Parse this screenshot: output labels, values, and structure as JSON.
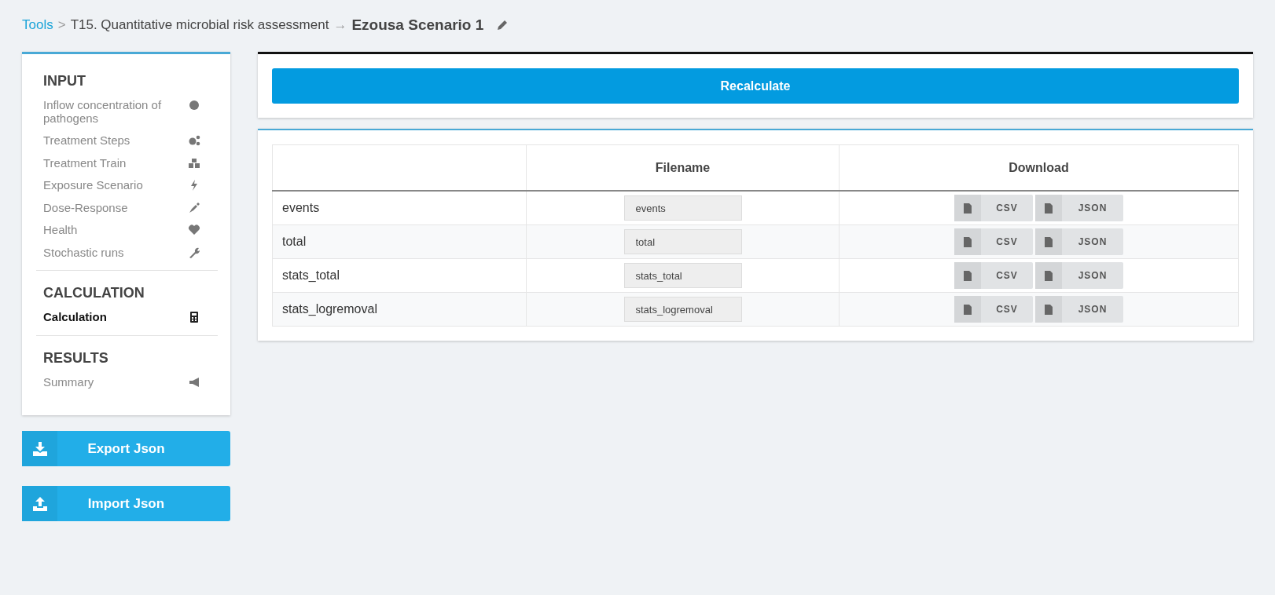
{
  "breadcrumb": {
    "root": "Tools",
    "separator_1": ">",
    "parent": "T15. Quantitative microbial risk assessment",
    "separator_2": "→",
    "current": "Ezousa Scenario 1"
  },
  "sidebar": {
    "sections": [
      {
        "title": "INPUT",
        "items": [
          {
            "label": "Inflow concentration of pathogens",
            "selected": false
          },
          {
            "label": "Treatment Steps",
            "selected": false
          },
          {
            "label": "Treatment Train",
            "selected": false
          },
          {
            "label": "Exposure Scenario",
            "selected": false
          },
          {
            "label": "Dose-Response",
            "selected": false
          },
          {
            "label": "Health",
            "selected": false
          },
          {
            "label": "Stochastic runs",
            "selected": false
          }
        ]
      },
      {
        "title": "CALCULATION",
        "items": [
          {
            "label": "Calculation",
            "selected": true
          }
        ]
      },
      {
        "title": "RESULTS",
        "items": [
          {
            "label": "Summary",
            "selected": false
          }
        ]
      }
    ]
  },
  "sidebar_buttons": [
    {
      "kind": "export",
      "label": "Export Json"
    },
    {
      "kind": "import",
      "label": "Import Json"
    }
  ],
  "recalculate_button": "Recalculate",
  "table": {
    "columns": [
      "",
      "Filename",
      "Download"
    ],
    "rows": [
      {
        "name": "events",
        "filename": "events",
        "downloads": [
          "CSV",
          "JSON"
        ]
      },
      {
        "name": "total",
        "filename": "total",
        "downloads": [
          "CSV",
          "JSON"
        ]
      },
      {
        "name": "stats_total",
        "filename": "stats_total",
        "downloads": [
          "CSV",
          "JSON"
        ]
      },
      {
        "name": "stats_logremoval",
        "filename": "stats_logremoval",
        "downloads": [
          "CSV",
          "JSON"
        ]
      }
    ]
  }
}
